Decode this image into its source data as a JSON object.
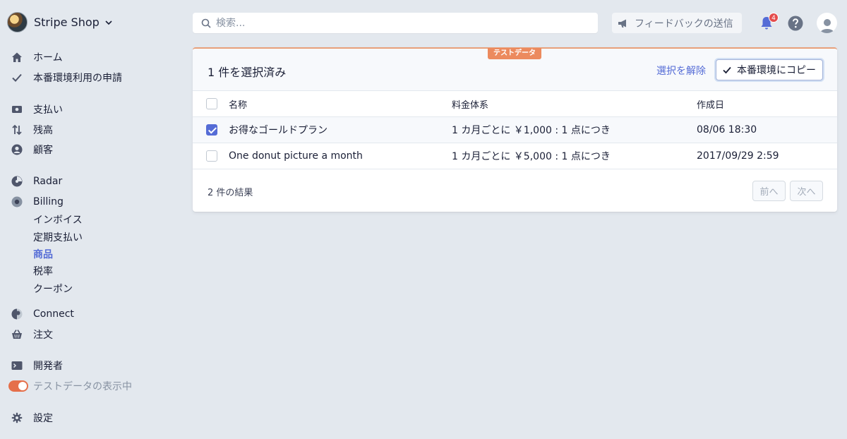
{
  "brand": {
    "name": "Stripe Shop"
  },
  "sidebar": {
    "items": [
      {
        "label": "ホーム",
        "icon": "home-icon"
      },
      {
        "label": "本番環境利用の申請",
        "icon": "check-icon"
      },
      {
        "label": "支払い",
        "icon": "payments-icon"
      },
      {
        "label": "残高",
        "icon": "balance-icon"
      },
      {
        "label": "顧客",
        "icon": "customer-icon"
      },
      {
        "label": "Radar",
        "icon": "radar-icon"
      },
      {
        "label": "Billing",
        "icon": "billing-icon"
      },
      {
        "label": "Connect",
        "icon": "connect-icon"
      },
      {
        "label": "注文",
        "icon": "basket-icon"
      },
      {
        "label": "開発者",
        "icon": "terminal-icon"
      },
      {
        "label": "テストデータの表示中",
        "icon": "toggle-icon"
      },
      {
        "label": "設定",
        "icon": "gear-icon"
      }
    ],
    "billing_sub": [
      "インボイス",
      "定期支払い",
      "商品",
      "税率",
      "クーポン"
    ]
  },
  "search": {
    "placeholder": "検索..."
  },
  "header": {
    "feedback_label": "フィードバックの送信",
    "notification_count": "4"
  },
  "card": {
    "badge": "テストデータ",
    "title": "1 件を選択済み",
    "deselect_label": "選択を解除",
    "copy_label": "本番環境にコピー",
    "columns": [
      "名称",
      "料金体系",
      "作成日"
    ],
    "rows": [
      {
        "name": "お得なゴールドプラン",
        "price": "1 カ月ごとに ￥1,000 : 1 点につき",
        "date": "08/06 18:30",
        "checked": true
      },
      {
        "name": "One donut picture a month",
        "price": "1 カ月ごとに ￥5,000 : 1 点につき",
        "date": "2017/09/29 2:59",
        "checked": false
      }
    ],
    "result_count": "2 件の結果",
    "prev_label": "前へ",
    "next_label": "次へ"
  },
  "colors": {
    "accent": "#556cd6",
    "test_badge": "#ec8a5e",
    "toggle": "#e56f4a",
    "background": "#e3e8ee"
  }
}
